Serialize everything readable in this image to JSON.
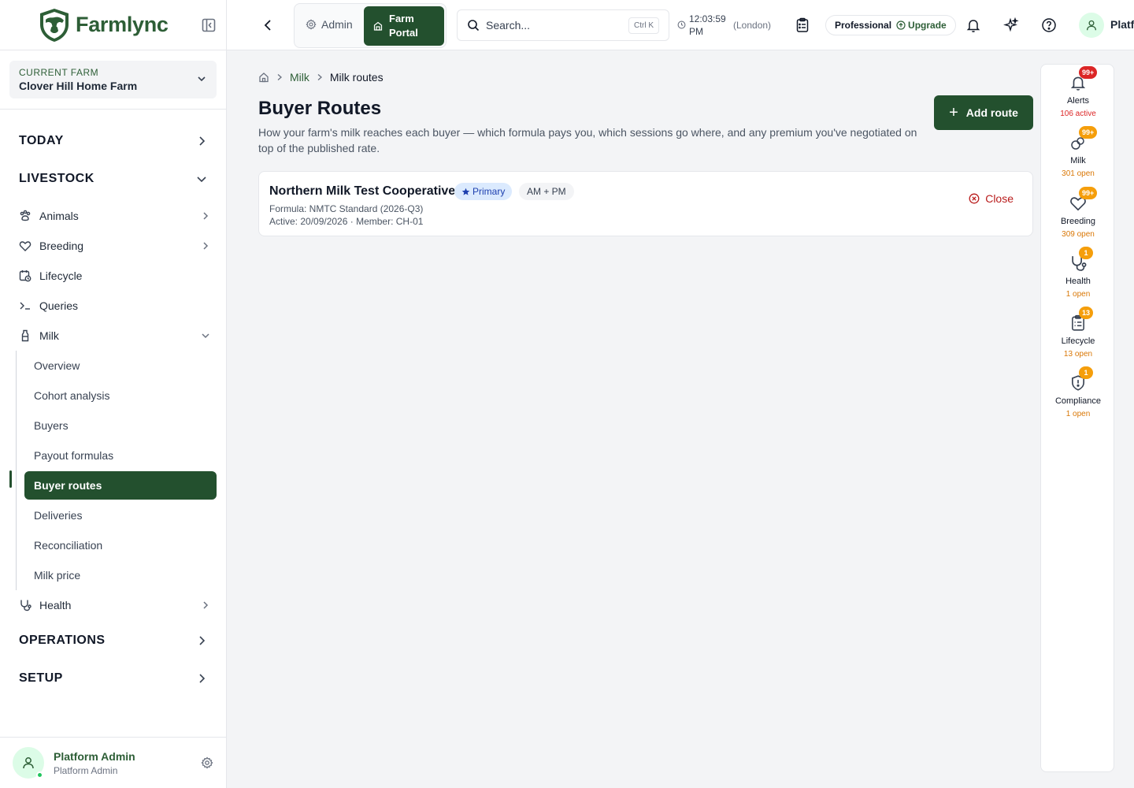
{
  "app": {
    "logo_text": "Farmlync"
  },
  "farm": {
    "label": "CURRENT FARM",
    "name": "Clover Hill Home Farm"
  },
  "nav": {
    "today": "TODAY",
    "livestock": "LIVESTOCK",
    "items": {
      "animals": "Animals",
      "breeding": "Breeding",
      "lifecycle": "Lifecycle",
      "queries": "Queries",
      "milk": "Milk",
      "health": "Health"
    },
    "milk_sub": [
      "Overview",
      "Cohort analysis",
      "Buyers",
      "Payout formulas",
      "Buyer routes",
      "Deliveries",
      "Reconciliation",
      "Milk price"
    ],
    "milk_active_index": 4,
    "operations": "OPERATIONS",
    "setup": "SETUP"
  },
  "user": {
    "name": "Platform Admin",
    "role": "Platform Admin",
    "top_name_visible": "Platf"
  },
  "topbar": {
    "admin_label": "Admin",
    "portal_label_1": "Farm",
    "portal_label_2": "Portal",
    "search_placeholder": "Search...",
    "search_shortcut": "Ctrl K",
    "time_1": "12:03:59",
    "time_2": "PM",
    "timezone": "(London)",
    "plan": "Professional",
    "upgrade": "Upgrade"
  },
  "breadcrumb": {
    "parent": "Milk",
    "current": "Milk routes"
  },
  "page": {
    "title": "Buyer Routes",
    "description": "How your farm's milk reaches each buyer — which formula pays you, which sessions go where, and any premium you've negotiated on top of the published rate.",
    "add_button": "Add route"
  },
  "routes": [
    {
      "buyer": "Northern Milk Test Cooperative",
      "primary_label": "Primary",
      "sessions": "AM + PM",
      "formula_line": "Formula: NMTC Standard (2026-Q3)",
      "active_line": "Active: 20/09/2026 · Member: CH-01",
      "close_label": "Close"
    }
  ],
  "rail": [
    {
      "label": "Alerts",
      "badge": "99+",
      "badge_color": "#dc2626",
      "count": "106 active",
      "count_color": "#dc2626",
      "icon": "bell-icon"
    },
    {
      "label": "Milk",
      "badge": "99+",
      "badge_color": "#f59e0b",
      "count": "301 open",
      "count_color": "#d97706",
      "icon": "milk-drop-icon"
    },
    {
      "label": "Breeding",
      "badge": "99+",
      "badge_color": "#f59e0b",
      "count": "309 open",
      "count_color": "#d97706",
      "icon": "heart-icon"
    },
    {
      "label": "Health",
      "badge": "1",
      "badge_color": "#f59e0b",
      "count": "1 open",
      "count_color": "#d97706",
      "icon": "stethoscope-icon"
    },
    {
      "label": "Lifecycle",
      "badge": "13",
      "badge_color": "#f59e0b",
      "count": "13 open",
      "count_color": "#d97706",
      "icon": "clipboard-icon"
    },
    {
      "label": "Compliance",
      "badge": "1",
      "badge_color": "#f59e0b",
      "count": "1 open",
      "count_color": "#d97706",
      "icon": "shield-alert-icon"
    }
  ]
}
